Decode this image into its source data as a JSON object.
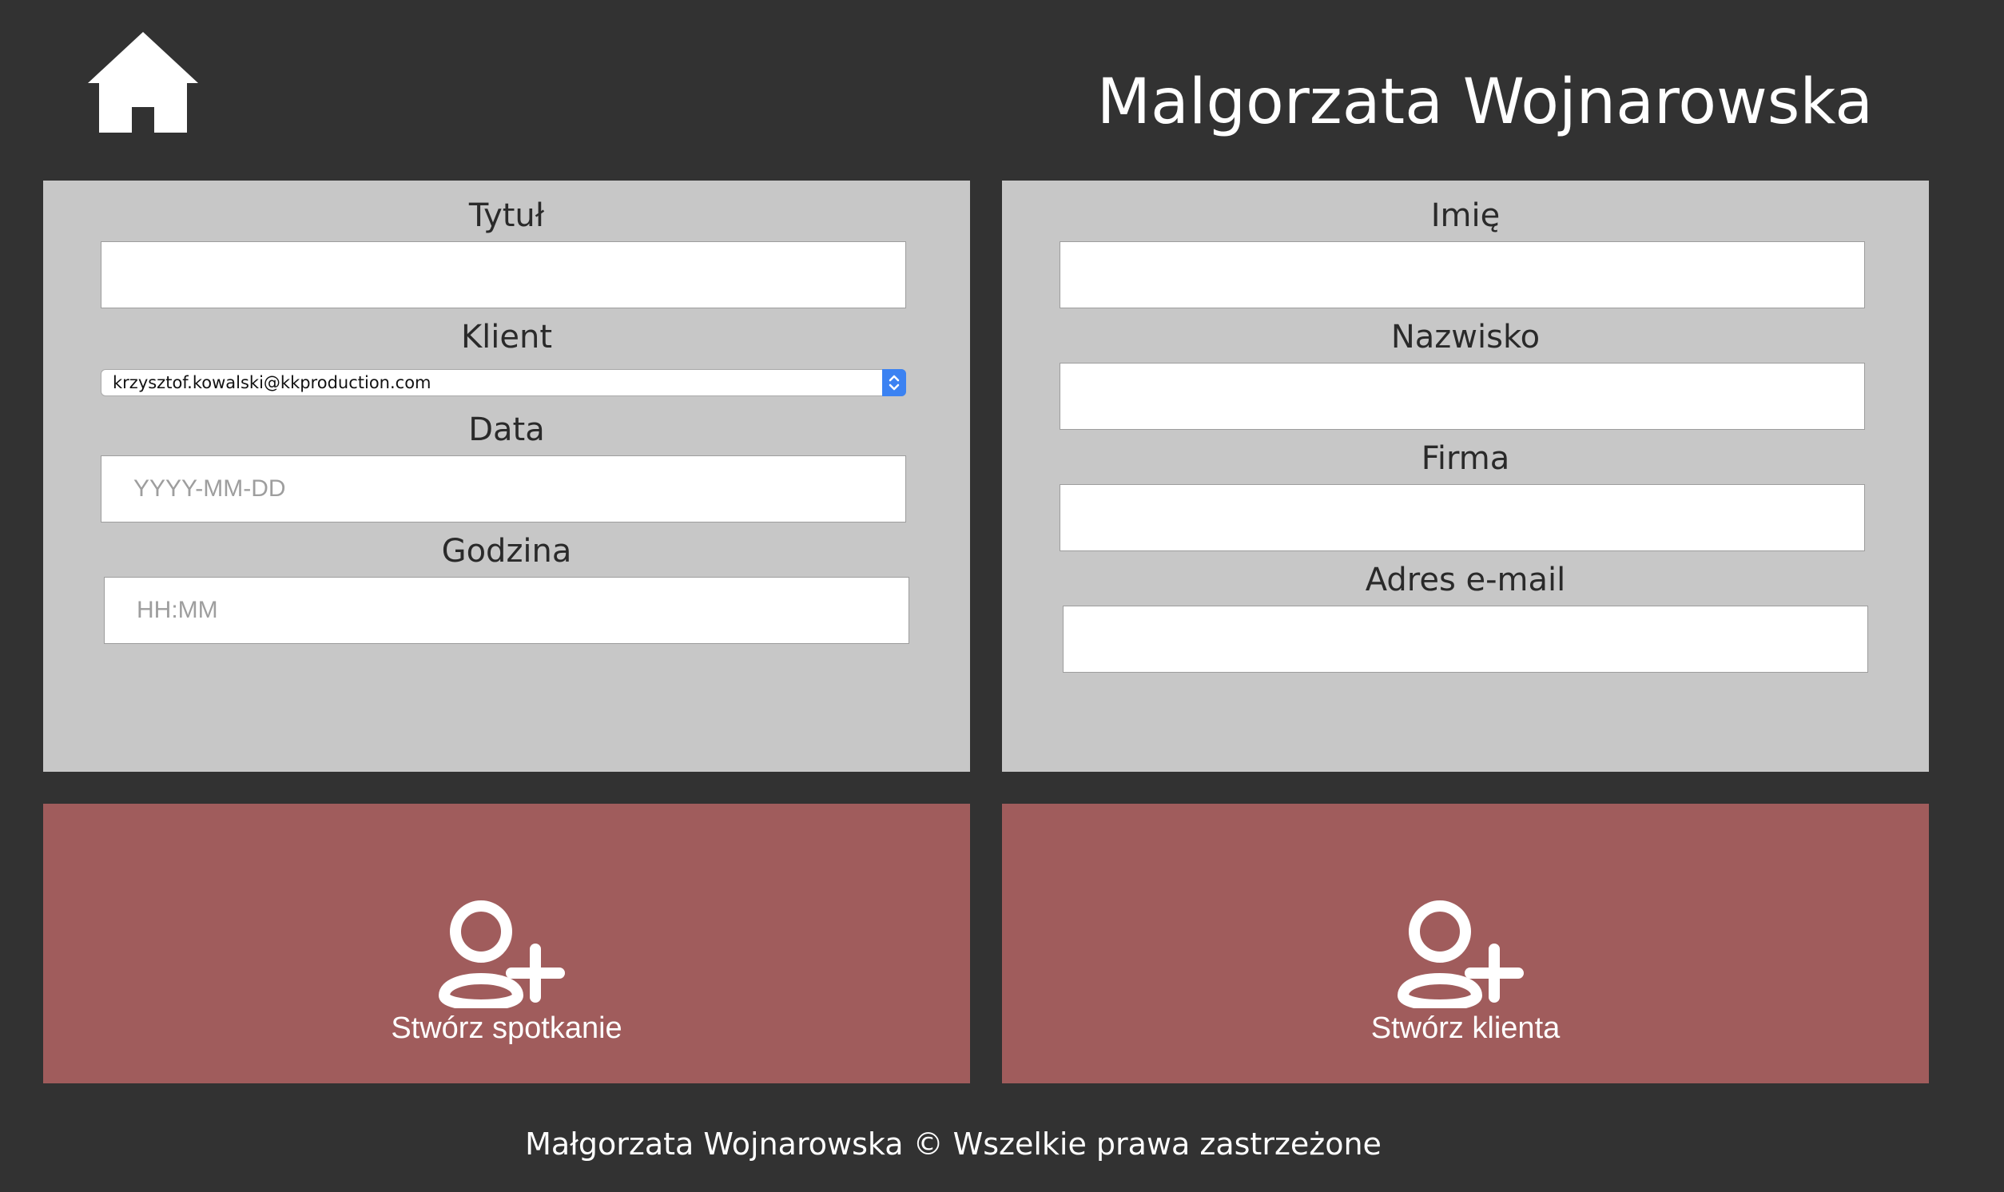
{
  "header": {
    "home_icon": "home-icon",
    "user_name": "Malgorzata Wojnarowska"
  },
  "meeting_form": {
    "title_label": "Tytuł",
    "title_value": "",
    "client_label": "Klient",
    "client_selected": "krzysztof.kowalski@kkproduction.com",
    "date_label": "Data",
    "date_placeholder": "YYYY-MM-DD",
    "time_label": "Godzina",
    "time_placeholder": "HH:MM"
  },
  "client_form": {
    "first_name_label": "Imię",
    "last_name_label": "Nazwisko",
    "company_label": "Firma",
    "email_label": "Adres e-mail"
  },
  "actions": {
    "create_meeting_label": "Stwórz spotkanie",
    "create_client_label": "Stwórz klienta",
    "icon": "add-user-icon"
  },
  "footer": {
    "text": "Małgorzata Wojnarowska © Wszelkie prawa zastrzeżone"
  },
  "colors": {
    "background": "#323232",
    "panel": "#c7c7c7",
    "action": "#a05c5c",
    "text_light": "#ffffff",
    "select_accent": "#3b82f2"
  }
}
